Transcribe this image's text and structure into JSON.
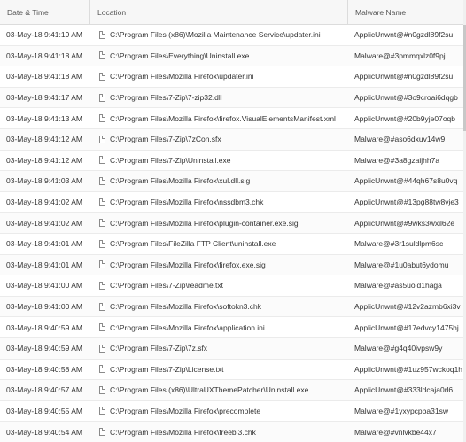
{
  "columns": {
    "date": "Date & Time",
    "location": "Location",
    "malware": "Malware Name"
  },
  "rows": [
    {
      "date": "03-May-18 9:41:19 AM",
      "location": "C:\\Program Files (x86)\\Mozilla Maintenance Service\\updater.ini",
      "malware": "ApplicUnwnt@#n0gzdl89f2su"
    },
    {
      "date": "03-May-18 9:41:18 AM",
      "location": "C:\\Program Files\\Everything\\Uninstall.exe",
      "malware": "Malware@#3pmmqxlz0f9pj"
    },
    {
      "date": "03-May-18 9:41:18 AM",
      "location": "C:\\Program Files\\Mozilla Firefox\\updater.ini",
      "malware": "ApplicUnwnt@#n0gzdl89f2su"
    },
    {
      "date": "03-May-18 9:41:17 AM",
      "location": "C:\\Program Files\\7-Zip\\7-zip32.dll",
      "malware": "ApplicUnwnt@#3o9croai6dqgb"
    },
    {
      "date": "03-May-18 9:41:13 AM",
      "location": "C:\\Program Files\\Mozilla Firefox\\firefox.VisualElementsManifest.xml",
      "malware": "ApplicUnwnt@#20b9yje07oqb"
    },
    {
      "date": "03-May-18 9:41:12 AM",
      "location": "C:\\Program Files\\7-Zip\\7zCon.sfx",
      "malware": "Malware@#aso6dxuv14w9"
    },
    {
      "date": "03-May-18 9:41:12 AM",
      "location": "C:\\Program Files\\7-Zip\\Uninstall.exe",
      "malware": "Malware@#3a8gzaijhh7a"
    },
    {
      "date": "03-May-18 9:41:03 AM",
      "location": "C:\\Program Files\\Mozilla Firefox\\xul.dll.sig",
      "malware": "ApplicUnwnt@#44qh67s8u0vq"
    },
    {
      "date": "03-May-18 9:41:02 AM",
      "location": "C:\\Program Files\\Mozilla Firefox\\nssdbm3.chk",
      "malware": "ApplicUnwnt@#13pg88tw8vje3"
    },
    {
      "date": "03-May-18 9:41:02 AM",
      "location": "C:\\Program Files\\Mozilla Firefox\\plugin-container.exe.sig",
      "malware": "ApplicUnwnt@#9wks3wxil62e"
    },
    {
      "date": "03-May-18 9:41:01 AM",
      "location": "C:\\Program Files\\FileZilla FTP Client\\uninstall.exe",
      "malware": "Malware@#3r1suldlpm6sc"
    },
    {
      "date": "03-May-18 9:41:01 AM",
      "location": "C:\\Program Files\\Mozilla Firefox\\firefox.exe.sig",
      "malware": "Malware@#1u0abut6ydomu"
    },
    {
      "date": "03-May-18 9:41:00 AM",
      "location": "C:\\Program Files\\7-Zip\\readme.txt",
      "malware": "Malware@#as5uold1haga"
    },
    {
      "date": "03-May-18 9:41:00 AM",
      "location": "C:\\Program Files\\Mozilla Firefox\\softokn3.chk",
      "malware": "ApplicUnwnt@#12v2azmb6xi3v"
    },
    {
      "date": "03-May-18 9:40:59 AM",
      "location": "C:\\Program Files\\Mozilla Firefox\\application.ini",
      "malware": "ApplicUnwnt@#17edvcy1475hj"
    },
    {
      "date": "03-May-18 9:40:59 AM",
      "location": "C:\\Program Files\\7-Zip\\7z.sfx",
      "malware": "Malware@#g4q40ivpsw9y"
    },
    {
      "date": "03-May-18 9:40:58 AM",
      "location": "C:\\Program Files\\7-Zip\\License.txt",
      "malware": "ApplicUnwnt@#1uz957wckoq1h"
    },
    {
      "date": "03-May-18 9:40:57 AM",
      "location": "C:\\Program Files (x86)\\UltraUXThemePatcher\\Uninstall.exe",
      "malware": "ApplicUnwnt@#333ldcaja0rl6"
    },
    {
      "date": "03-May-18 9:40:55 AM",
      "location": "C:\\Program Files\\Mozilla Firefox\\precomplete",
      "malware": "Malware@#1yxypcpba31sw"
    },
    {
      "date": "03-May-18 9:40:54 AM",
      "location": "C:\\Program Files\\Mozilla Firefox\\freebl3.chk",
      "malware": "Malware@#vnlvkbe44x7"
    }
  ]
}
